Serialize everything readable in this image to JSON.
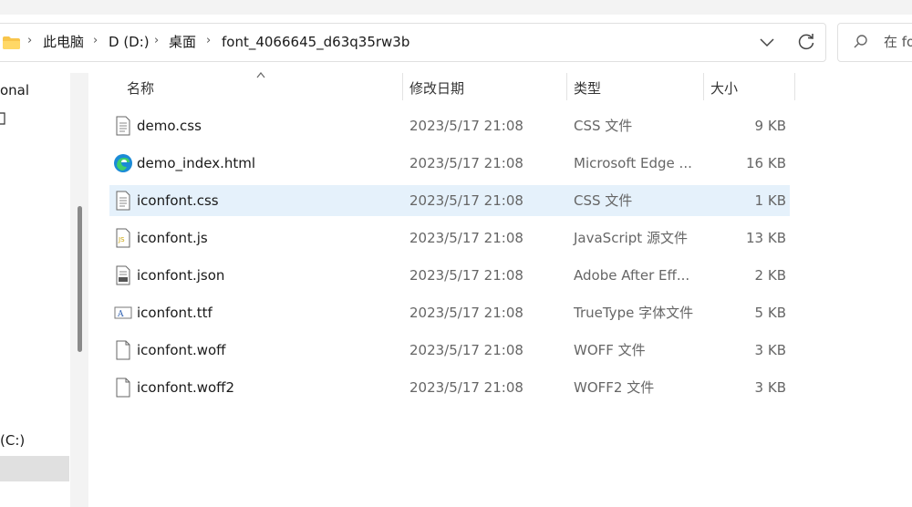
{
  "breadcrumb": {
    "items": [
      "此电脑",
      "D (D:)",
      "桌面",
      "font_4066645_d63q35rw3b"
    ]
  },
  "search": {
    "placeholder": "在 fo"
  },
  "nav": {
    "items": [
      {
        "label": "onal"
      },
      {
        "label": ""
      },
      {
        "label": "(C:)"
      }
    ]
  },
  "columns": {
    "name": "名称",
    "date": "修改日期",
    "type": "类型",
    "size": "大小"
  },
  "files": [
    {
      "name": "demo.css",
      "date": "2023/5/17 21:08",
      "type": "CSS 文件",
      "size": "9 KB",
      "icon": "css-file-icon"
    },
    {
      "name": "demo_index.html",
      "date": "2023/5/17 21:08",
      "type": "Microsoft Edge ...",
      "size": "16 KB",
      "icon": "edge-html-icon"
    },
    {
      "name": "iconfont.css",
      "date": "2023/5/17 21:08",
      "type": "CSS 文件",
      "size": "1 KB",
      "icon": "css-file-icon",
      "selected": true
    },
    {
      "name": "iconfont.js",
      "date": "2023/5/17 21:08",
      "type": "JavaScript 源文件",
      "size": "13 KB",
      "icon": "js-file-icon"
    },
    {
      "name": "iconfont.json",
      "date": "2023/5/17 21:08",
      "type": "Adobe After Eff...",
      "size": "2 KB",
      "icon": "json-file-icon"
    },
    {
      "name": "iconfont.ttf",
      "date": "2023/5/17 21:08",
      "type": "TrueType 字体文件",
      "size": "5 KB",
      "icon": "font-file-icon"
    },
    {
      "name": "iconfont.woff",
      "date": "2023/5/17 21:08",
      "type": "WOFF 文件",
      "size": "3 KB",
      "icon": "blank-file-icon"
    },
    {
      "name": "iconfont.woff2",
      "date": "2023/5/17 21:08",
      "type": "WOFF2 文件",
      "size": "3 KB",
      "icon": "blank-file-icon"
    }
  ],
  "colors": {
    "selected_row": "#e5f1fb",
    "folder": "#f8c54b",
    "nav_selected": "#e0e0e0"
  }
}
